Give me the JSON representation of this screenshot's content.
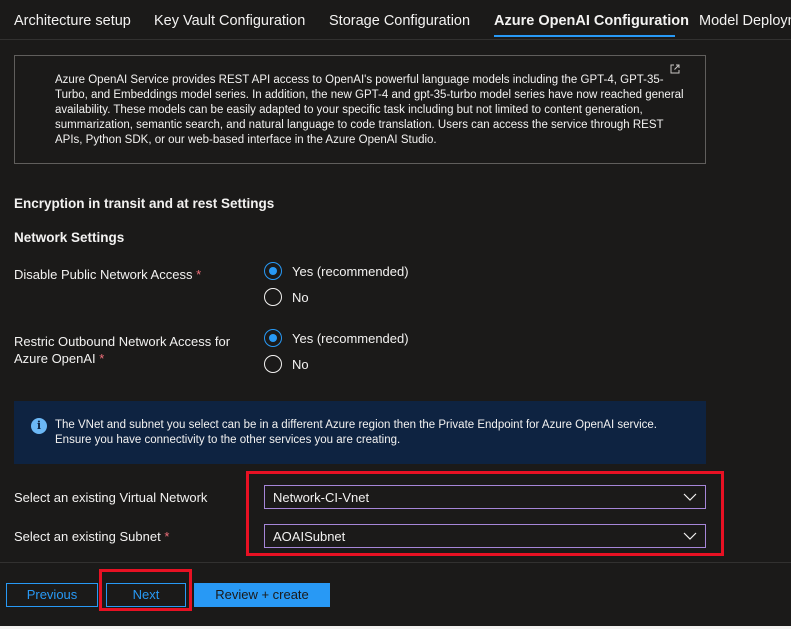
{
  "tabs": [
    {
      "label": "Architecture setup",
      "active": false
    },
    {
      "label": "Key Vault Configuration",
      "active": false
    },
    {
      "label": "Storage Configuration",
      "active": false
    },
    {
      "label": "Azure OpenAI Configuration",
      "active": true
    },
    {
      "label": "Model Deployments",
      "active": false
    }
  ],
  "info": {
    "text": "Azure OpenAI Service provides REST API access to OpenAI's powerful language models including the GPT-4, GPT-35-Turbo, and Embeddings model series. In addition, the new GPT-4 and gpt-35-turbo model series have now reached general availability. These models can be easily adapted to your specific task including but not limited to content generation, summarization, semantic search, and natural language to code translation. Users can access the service through REST APIs, Python SDK, or our web-based interface in the Azure OpenAI Studio.",
    "icon": "external-link-icon"
  },
  "encryption_heading": "Encryption in transit and at rest Settings",
  "network_heading": "Network Settings",
  "disable_public": {
    "label": "Disable Public Network Access",
    "required_mark": "*",
    "options": [
      "Yes (recommended)",
      "No"
    ],
    "selected": "Yes (recommended)"
  },
  "restrict_outbound": {
    "label_line1": "Restric Outbound Network Access for",
    "label_line2": "Azure OpenAI",
    "required_mark": "*",
    "options": [
      "Yes (recommended)",
      "No"
    ],
    "selected": "Yes (recommended)"
  },
  "notice": {
    "icon": "info-icon",
    "icon_glyph": "i",
    "text": "The VNet and subnet you select can be in a different Azure region then the Private Endpoint for Azure OpenAI service. Ensure you have connectivity to the other services you are creating."
  },
  "vnet": {
    "label": "Select an existing Virtual Network",
    "value": "Network-CI-Vnet"
  },
  "subnet": {
    "label": "Select an existing Subnet",
    "required_mark": "*",
    "value": "AOAISubnet"
  },
  "buttons": {
    "previous": "Previous",
    "next": "Next",
    "review": "Review + create"
  },
  "colors": {
    "accent": "#2899f5",
    "highlight": "#e81123",
    "required": "#f1707b",
    "background": "#1b1a19"
  }
}
